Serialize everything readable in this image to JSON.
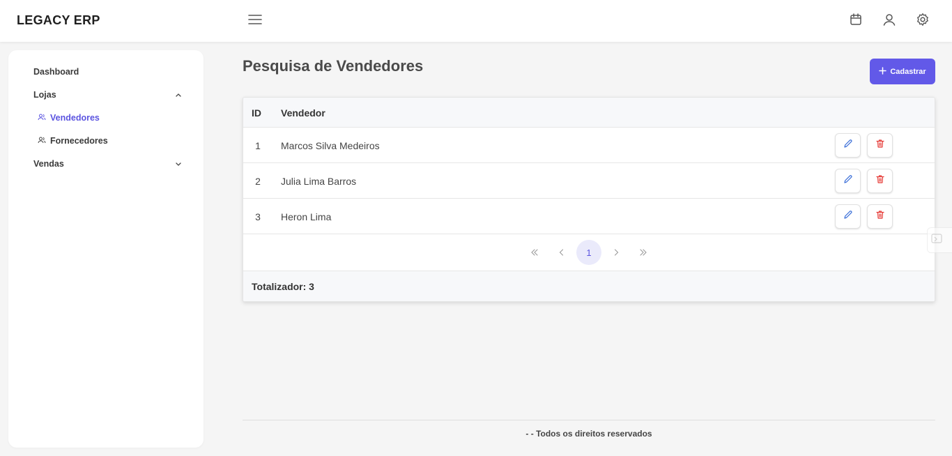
{
  "app": {
    "title": "LEGACY ERP"
  },
  "header": {
    "icons": [
      "menu-icon",
      "calendar-icon",
      "user-icon",
      "settings-icon"
    ]
  },
  "sidebar": {
    "items": [
      {
        "label": "Dashboard"
      },
      {
        "label": "Lojas",
        "expanded": true,
        "children": [
          {
            "label": "Vendedores",
            "active": true,
            "icon": "users-icon"
          },
          {
            "label": "Fornecedores",
            "active": false,
            "icon": "users-icon"
          }
        ]
      },
      {
        "label": "Vendas",
        "expanded": false
      }
    ]
  },
  "main": {
    "title": "Pesquisa de Vendedores",
    "add_button_label": "Cadastrar",
    "table": {
      "columns": [
        "ID",
        "Vendedor"
      ],
      "rows": [
        {
          "id": "1",
          "name": "Marcos Silva Medeiros"
        },
        {
          "id": "2",
          "name": "Julia Lima Barros"
        },
        {
          "id": "3",
          "name": "Heron Lima"
        }
      ],
      "pagination": {
        "current_page": "1"
      },
      "total_label": "Totalizador: 3"
    }
  },
  "footer": {
    "text": "-  - Todos os direitos reservados"
  },
  "colors": {
    "accent": "#6259e8",
    "danger": "#e53935",
    "edit": "#3b6fd8"
  }
}
